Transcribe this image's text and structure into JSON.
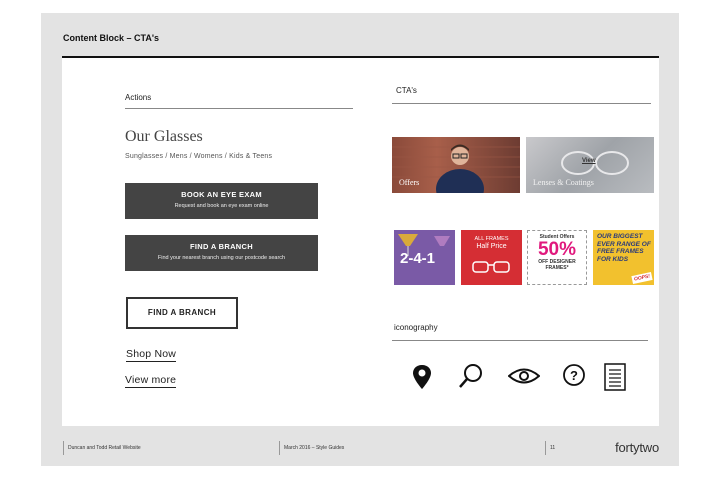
{
  "header": {
    "title": "Content Block – CTA's"
  },
  "left": {
    "actions_label": "Actions",
    "heading": "Our Glasses",
    "subnav": "Sunglasses  /  Mens  /  Womens  /  Kids & Teens",
    "btn1": {
      "title": "BOOK AN EYE EXAM",
      "subtitle": "Request and book an eye exam online"
    },
    "btn2": {
      "title": "FIND A BRANCH",
      "subtitle": "Find your nearest branch using our postcode search"
    },
    "btn3": {
      "label": "FIND A BRANCH"
    },
    "links": {
      "shop": "Shop Now",
      "more": "View more"
    }
  },
  "right": {
    "ctas_label": "CTA's",
    "tile_offers": "Offers",
    "tile_lenses": "Lenses & Coatings",
    "tile_view": "View",
    "promo1": "2-4-1",
    "promo2": {
      "line1": "ALL FRAMES",
      "line2": "Half Price"
    },
    "promo3": {
      "line1": "Student Offers",
      "big": "50%",
      "line2": "OFF DESIGNER",
      "line3": "FRAMES*"
    },
    "promo4": {
      "line1": "OUR BIGGEST",
      "line2": "EVER RANGE OF",
      "line3": "FREE FRAMES",
      "line4": "FOR KIDS",
      "badge": "OOPS!"
    },
    "iconography_label": "iconography",
    "icons": [
      "location-pin-icon",
      "search-icon",
      "eye-icon",
      "help-icon",
      "document-icon"
    ]
  },
  "footer": {
    "client": "Duncan and Todd Retail Website",
    "date": "March 2016  –  Style Guides",
    "page": "11",
    "brand": "fortytwo"
  },
  "colors": {
    "frame": "#e3e3e3",
    "button_dark": "#444444",
    "promo_purple": "#7a5aa6",
    "promo_red": "#d52e34",
    "promo_pink": "#e0197d",
    "promo_yellow": "#f2c12e"
  }
}
